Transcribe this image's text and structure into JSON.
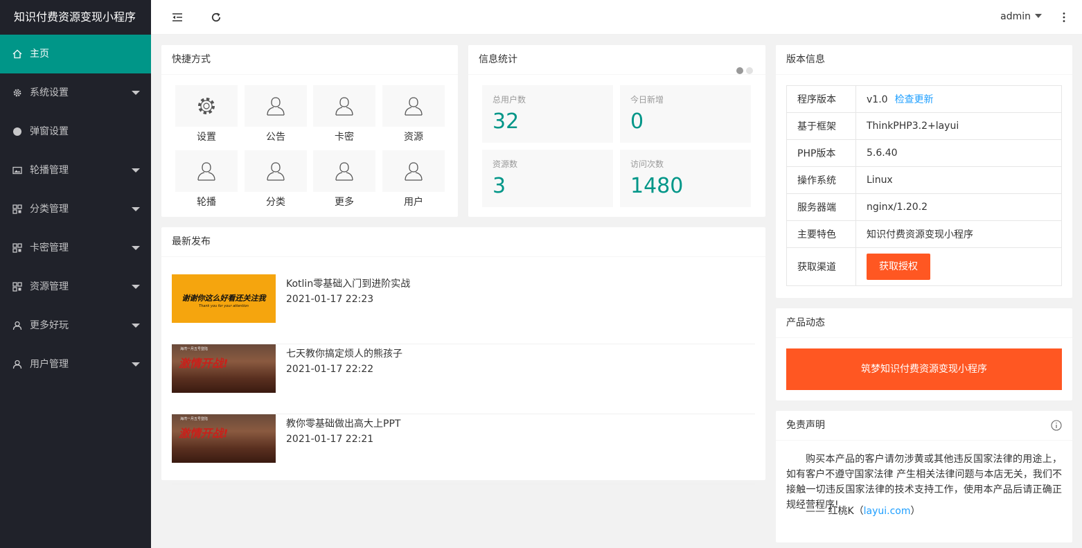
{
  "app": {
    "title": "知识付费资源变现小程序"
  },
  "sidebar": {
    "items": [
      {
        "label": "主页",
        "icon": "home-icon",
        "active": true,
        "caret": false
      },
      {
        "label": "系统设置",
        "icon": "gear-icon",
        "active": false,
        "caret": true
      },
      {
        "label": "弹窗设置",
        "icon": "circle-icon",
        "active": false,
        "caret": false
      },
      {
        "label": "轮播管理",
        "icon": "image-icon",
        "active": false,
        "caret": true
      },
      {
        "label": "分类管理",
        "icon": "app-grid-icon",
        "active": false,
        "caret": true
      },
      {
        "label": "卡密管理",
        "icon": "app-grid-icon",
        "active": false,
        "caret": true
      },
      {
        "label": "资源管理",
        "icon": "app-grid-icon",
        "active": false,
        "caret": true
      },
      {
        "label": "更多好玩",
        "icon": "user-icon",
        "active": false,
        "caret": true
      },
      {
        "label": "用户管理",
        "icon": "user-icon",
        "active": false,
        "caret": true
      }
    ]
  },
  "header": {
    "user": "admin"
  },
  "shortcuts": {
    "title": "快捷方式",
    "items": [
      {
        "label": "设置",
        "icon": "gear-icon"
      },
      {
        "label": "公告",
        "icon": "user-icon"
      },
      {
        "label": "卡密",
        "icon": "user-icon"
      },
      {
        "label": "资源",
        "icon": "user-icon"
      },
      {
        "label": "轮播",
        "icon": "user-icon"
      },
      {
        "label": "分类",
        "icon": "user-icon"
      },
      {
        "label": "更多",
        "icon": "user-icon"
      },
      {
        "label": "用户",
        "icon": "user-icon"
      }
    ]
  },
  "stats": {
    "title": "信息统计",
    "items": [
      {
        "label": "总用户数",
        "value": "32"
      },
      {
        "label": "今日新增",
        "value": "0"
      },
      {
        "label": "资源数",
        "value": "3"
      },
      {
        "label": "访问次数",
        "value": "1480"
      }
    ]
  },
  "latest": {
    "title": "最新发布",
    "thumb_banner": {
      "main": "谢谢你这么好看还关注我",
      "sub": "Thank you for your attention"
    },
    "thumb_war": {
      "main": "激情开战!",
      "sub": "海湾一月五号登陆"
    },
    "posts": [
      {
        "title": "Kotlin零基础入门到进阶实战",
        "date": "2021-01-17 22:23",
        "thumb": "banner"
      },
      {
        "title": "七天教你搞定烦人的熊孩子",
        "date": "2021-01-17 22:22",
        "thumb": "war"
      },
      {
        "title": "教你零基础做出高大上PPT",
        "date": "2021-01-17 22:21",
        "thumb": "war"
      }
    ]
  },
  "version": {
    "title": "版本信息",
    "rows": [
      {
        "key": "程序版本",
        "value": "v1.0",
        "link": "检查更新"
      },
      {
        "key": "基于框架",
        "value": "ThinkPHP3.2+layui"
      },
      {
        "key": "PHP版本",
        "value": "5.6.40"
      },
      {
        "key": "操作系统",
        "value": "Linux"
      },
      {
        "key": "服务器端",
        "value": "nginx/1.20.2"
      },
      {
        "key": "主要特色",
        "value": "知识付费资源变现小程序"
      }
    ],
    "channel_key": "获取渠道",
    "channel_button": "获取授权"
  },
  "product": {
    "title": "产品动态",
    "banner": "筑梦知识付费资源变现小程序"
  },
  "disclaimer": {
    "title": "免责声明",
    "text": "购买本产品的客户请勿涉黄或其他违反国家法律的用途上，如有客户不遵守国家法律 产生相关法律问题与本店无关，我们不接触一切违反国家法律的技术支持工作，使用本产品后请正确正规经营程序!",
    "sign_prefix": "—— 红桃K（",
    "sign_link": "layui.com",
    "sign_suffix": "）"
  },
  "colors": {
    "primary": "#009688",
    "accent": "#ff5722",
    "link": "#1e9fff",
    "sidebar": "#20222a"
  }
}
